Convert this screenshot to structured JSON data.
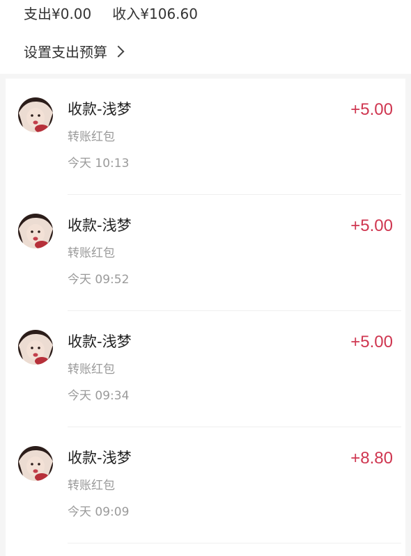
{
  "summary": {
    "expense_label": "支出",
    "expense_value": "¥0.00",
    "income_label": "收入",
    "income_value": "¥106.60",
    "budget_link": "设置支出预算"
  },
  "icons": {
    "budget_chevron": "chevron-right-icon",
    "avatar": "avatar-photo"
  },
  "colors": {
    "amount": "#cf3650",
    "secondary_text": "#9a9a9a",
    "primary_text": "#1f1f1f"
  },
  "transactions": [
    {
      "title": "收款-浅梦",
      "subtitle": "转账红包",
      "time": "今天 10:13",
      "amount": "+5.00"
    },
    {
      "title": "收款-浅梦",
      "subtitle": "转账红包",
      "time": "今天 09:52",
      "amount": "+5.00"
    },
    {
      "title": "收款-浅梦",
      "subtitle": "转账红包",
      "time": "今天 09:34",
      "amount": "+5.00"
    },
    {
      "title": "收款-浅梦",
      "subtitle": "转账红包",
      "time": "今天 09:09",
      "amount": "+8.80"
    }
  ]
}
